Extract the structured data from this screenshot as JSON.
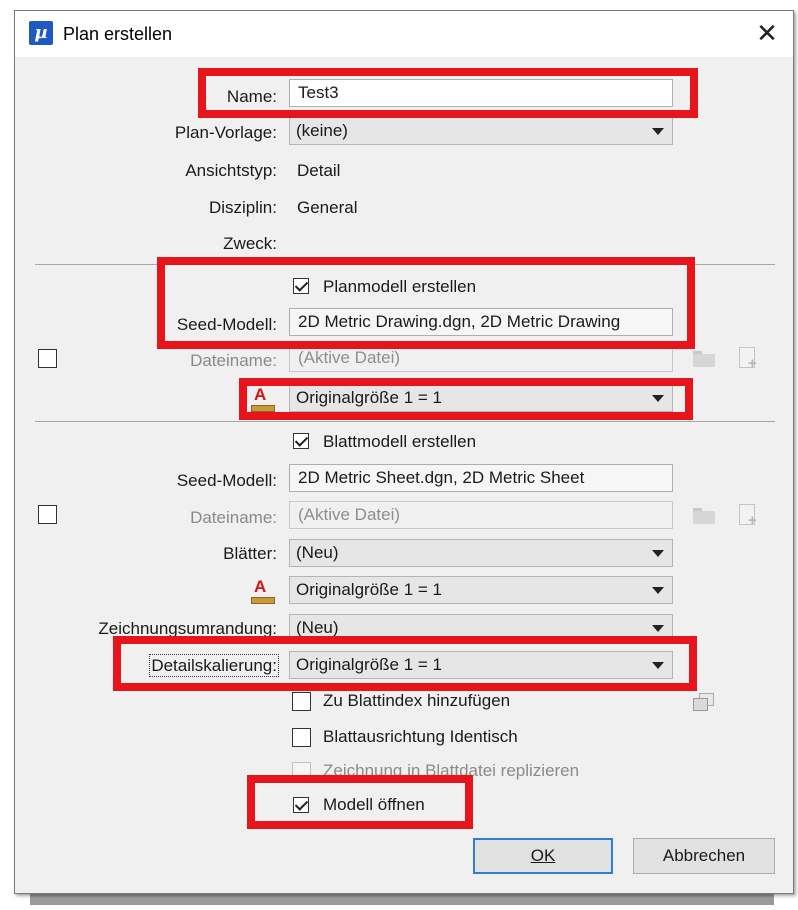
{
  "window": {
    "title": "Plan erstellen",
    "close_label": "✕",
    "app_icon_label": "µ"
  },
  "general": {
    "name_label": "Name:",
    "name_value": "Test3",
    "vorlage_label": "Plan-Vorlage:",
    "vorlage_value": "(keine)",
    "ansichtstyp_label": "Ansichtstyp:",
    "ansichtstyp_value": "Detail",
    "disziplin_label": "Disziplin:",
    "disziplin_value": "General",
    "zweck_label": "Zweck:"
  },
  "planmodel": {
    "create_label": "Planmodell erstellen",
    "create_checked": true,
    "seed_label": "Seed-Modell:",
    "seed_value": "2D Metric Drawing.dgn, 2D Metric Drawing",
    "file_label": "Dateiname:",
    "file_value": "(Aktive Datei)",
    "scale_value": "Originalgröße 1 = 1"
  },
  "sheetmodel": {
    "create_label": "Blattmodell erstellen",
    "create_checked": true,
    "seed_label": "Seed-Modell:",
    "seed_value": "2D Metric Sheet.dgn, 2D Metric Sheet",
    "file_label": "Dateiname:",
    "file_value": "(Aktive Datei)",
    "sheets_label": "Blätter:",
    "sheets_value": "(Neu)",
    "scale_value": "Originalgröße 1 = 1",
    "border_label": "Zeichnungsumrandung:",
    "border_value": "(Neu)",
    "detail_scale_label": "Detailskalierung:",
    "detail_scale_value": "Originalgröße 1 = 1"
  },
  "options": {
    "add_index_label": "Zu Blattindex hinzufügen",
    "same_orientation_label": "Blattausrichtung Identisch",
    "replicate_label": "Zeichnung in Blattdatei replizieren",
    "open_model_label": "Modell öffnen",
    "open_model_checked": true
  },
  "buttons": {
    "ok_label": "OK",
    "cancel_label": "Abbrechen"
  },
  "colors": {
    "highlight": "#e8141b",
    "default_button_border": "#2f7fd8",
    "scale_icon": "#d01818"
  }
}
